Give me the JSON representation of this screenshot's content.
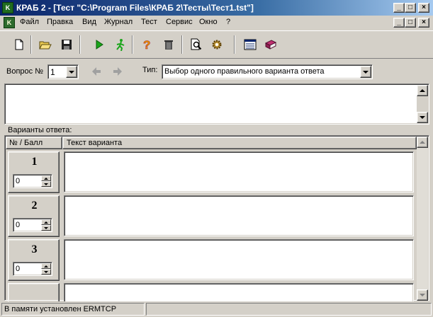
{
  "window": {
    "title": "КРАБ 2 - [Тест \"C:\\Program Files\\КРАБ 2\\Тесты\\Тест1.tst\"]",
    "app_icon_text": "K",
    "caption_buttons": [
      "_",
      "□",
      "×"
    ]
  },
  "menu": {
    "items": [
      "Файл",
      "Правка",
      "Вид",
      "Журнал",
      "Тест",
      "Сервис",
      "Окно",
      "?"
    ]
  },
  "toolbar": {
    "buttons": [
      {
        "icon": "new-document-icon"
      },
      {
        "icon": "open-folder-icon"
      },
      {
        "icon": "save-disk-icon"
      },
      {
        "icon": "play-run-icon"
      },
      {
        "icon": "running-man-icon"
      },
      {
        "icon": "help-question-icon"
      },
      {
        "icon": "trash-delete-icon"
      },
      {
        "icon": "print-preview-icon"
      },
      {
        "icon": "settings-gear-icon"
      },
      {
        "icon": "list-window-icon"
      },
      {
        "icon": "book-icon"
      }
    ]
  },
  "question": {
    "label": "Вопрос №",
    "number": "1",
    "type_label": "Тип:",
    "type_value": "Выбор одного правильного варианта ответа",
    "text": ""
  },
  "answers": {
    "label": "Варианты ответа:",
    "col_num": "№ / Балл",
    "col_text": "Текст варианта",
    "rows": [
      {
        "num": "1",
        "score": "0",
        "text": ""
      },
      {
        "num": "2",
        "score": "0",
        "text": ""
      },
      {
        "num": "3",
        "score": "0",
        "text": ""
      }
    ]
  },
  "status": {
    "left": "В памяти установлен ERMTCP",
    "right": ""
  }
}
